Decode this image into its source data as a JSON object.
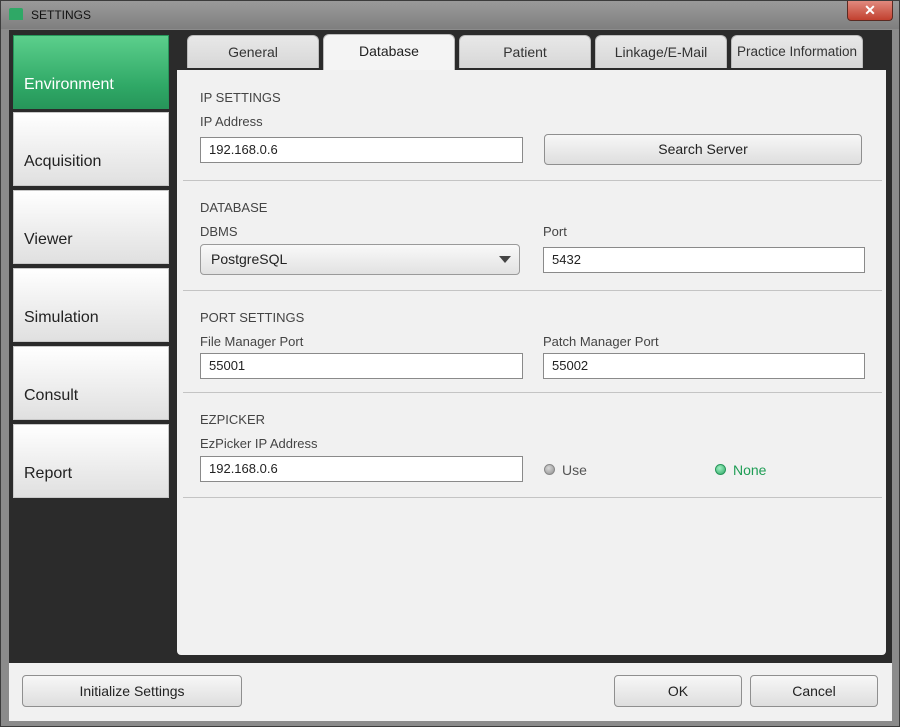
{
  "window": {
    "title": "SETTINGS",
    "close_label": "✕"
  },
  "sidebar": {
    "items": [
      {
        "label": "Environment",
        "active": true
      },
      {
        "label": "Acquisition",
        "active": false
      },
      {
        "label": "Viewer",
        "active": false
      },
      {
        "label": "Simulation",
        "active": false
      },
      {
        "label": "Consult",
        "active": false
      },
      {
        "label": "Report",
        "active": false
      }
    ]
  },
  "tabs": [
    {
      "label": "General",
      "active": false
    },
    {
      "label": "Database",
      "active": true
    },
    {
      "label": "Patient",
      "active": false
    },
    {
      "label": "Linkage/E-Mail",
      "active": false
    },
    {
      "label": "Practice Information",
      "active": false
    }
  ],
  "ip_settings": {
    "title": "IP SETTINGS",
    "ip_label": "IP Address",
    "ip_value": "192.168.0.6",
    "search_button": "Search Server"
  },
  "database": {
    "title": "DATABASE",
    "dbms_label": "DBMS",
    "dbms_value": "PostgreSQL",
    "port_label": "Port",
    "port_value": "5432"
  },
  "port_settings": {
    "title": "PORT SETTINGS",
    "file_manager_label": "File Manager Port",
    "file_manager_value": "55001",
    "patch_manager_label": "Patch Manager Port",
    "patch_manager_value": "55002"
  },
  "ezpicker": {
    "title": "EZPICKER",
    "ip_label": "EzPicker IP Address",
    "ip_value": "192.168.0.6",
    "use_label": "Use",
    "none_label": "None",
    "selected": "None"
  },
  "footer": {
    "initialize_button": "Initialize Settings",
    "ok_button": "OK",
    "cancel_button": "Cancel"
  },
  "colors": {
    "accent": "#2fa866",
    "selected_text": "#1f9d55"
  }
}
